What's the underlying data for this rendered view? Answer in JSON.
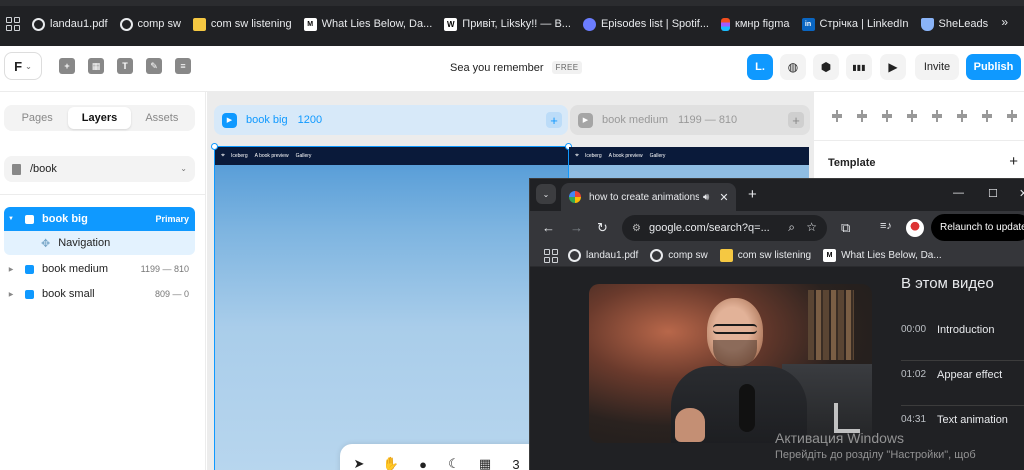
{
  "bookmarks_bar": {
    "items": [
      {
        "label": "landau1.pdf",
        "icon": "globe-icon"
      },
      {
        "label": "comp sw",
        "icon": "globe-icon"
      },
      {
        "label": "com sw listening",
        "icon": "yellow-square-icon"
      },
      {
        "label": "What Lies Below, Da...",
        "icon": "medium-logo-icon",
        "badge": "M"
      },
      {
        "label": "Привіт, Liksky!! — B...",
        "icon": "w-logo-icon",
        "badge": "W"
      },
      {
        "label": "Episodes list | Spotif...",
        "icon": "spotify-icon"
      },
      {
        "label": "кмнр figma",
        "icon": "figma-icon"
      },
      {
        "label": "Стрічка | LinkedIn",
        "icon": "linkedin-icon",
        "badge": "in"
      },
      {
        "label": "SheLeads",
        "icon": "graduation-cap-icon"
      }
    ],
    "more": "»"
  },
  "toolbar": {
    "logo": "F",
    "tools": [
      "plus-icon",
      "layout-icon",
      "text-icon",
      "edit-icon",
      "database-icon"
    ],
    "tool_glyphs": [
      "+",
      "▦",
      "T",
      "✎",
      "≡"
    ],
    "project_name": "Sea you remember",
    "plan_badge": "FREE",
    "user_initial": "L.",
    "right_glyphs": [
      "◍",
      "⬢",
      "▮▮▮",
      "▶"
    ],
    "invite_label": "Invite",
    "publish_label": "Publish"
  },
  "left_panel": {
    "tabs": [
      {
        "label": "Pages",
        "active": false
      },
      {
        "label": "Layers",
        "active": true
      },
      {
        "label": "Assets",
        "active": false
      }
    ],
    "page_path": "/book",
    "layers": [
      {
        "name": "book big",
        "meta": "Primary",
        "selected": true,
        "expanded": true
      },
      {
        "name": "Navigation",
        "child": true
      },
      {
        "name": "book medium",
        "meta": "1199 — 810"
      },
      {
        "name": "book small",
        "meta": "809 — 0"
      }
    ]
  },
  "canvas": {
    "breakpoints": [
      {
        "name": "book big",
        "size": "1200",
        "active": true
      },
      {
        "name": "book medium",
        "size": "1199 — 810",
        "active": false
      }
    ],
    "frame_nav": {
      "logo": "⌖",
      "links": [
        "Iceberg",
        "A book preview",
        "Gallery"
      ]
    },
    "bottom_tools": [
      "cursor-icon",
      "hand-icon",
      "circle-icon",
      "moon-icon",
      "grid-icon"
    ],
    "bottom_glyphs": [
      "➤",
      "✋",
      "●",
      "☾",
      "▦",
      "3"
    ]
  },
  "right_panel": {
    "section_title": "Template",
    "add_glyph": "+"
  },
  "chrome_window": {
    "tab_title": "how to create animations in",
    "tab_close": "✕",
    "new_tab": "+",
    "window_controls": [
      "—",
      "☐",
      "✕"
    ],
    "url": "google.com/search?q=...",
    "relaunch_label": "Relaunch to update",
    "bookmarks": [
      {
        "label": "landau1.pdf",
        "icon": "globe-icon"
      },
      {
        "label": "comp sw",
        "icon": "globe-icon"
      },
      {
        "label": "com sw listening",
        "icon": "yellow-square-icon"
      },
      {
        "label": "What Lies Below, Da...",
        "icon": "medium-logo-icon",
        "badge": "M"
      }
    ],
    "chapters_title": "В этом видео",
    "chapters": [
      {
        "time": "00:00",
        "title": "Introduction"
      },
      {
        "time": "01:02",
        "title": "Appear effect"
      },
      {
        "time": "04:31",
        "title": "Text animation"
      }
    ]
  },
  "watermark": {
    "line1": "Активация Windows",
    "line2": "Перейдіть до розділу \"Настройки\", щоб"
  },
  "colors": {
    "accent": "#0f99ff",
    "chrome_dark": "#202124",
    "bookmark_bar": "#202124"
  }
}
